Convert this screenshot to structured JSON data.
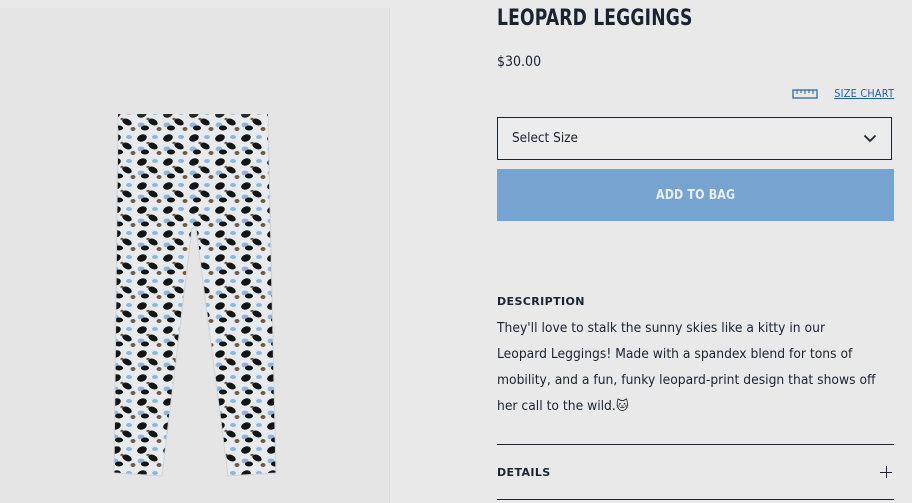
{
  "product": {
    "title": "LEOPARD LEGGINGS",
    "price": "$30.00",
    "image_alt": "leopard-print leggings"
  },
  "size_chart": {
    "label": "SIZE CHART",
    "icon": "ruler-icon"
  },
  "size_select": {
    "placeholder": "Select Size",
    "icon": "chevron-down-icon"
  },
  "add_to_bag": {
    "label": "ADD TO BAG"
  },
  "description": {
    "heading": "DESCRIPTION",
    "text": "They'll love to stalk the sunny skies like a kitty in our Leopard Leggings! Made with a spandex blend for tons of mobility, and a fun, funky leopard-print design that shows off her call to the wild.🐱"
  },
  "details": {
    "label": "DETAILS",
    "icon": "plus-icon"
  },
  "colors": {
    "text": "#1a2332",
    "link": "#1f5fa8",
    "button": "#76a3d0",
    "background": "#e9e9e9"
  }
}
